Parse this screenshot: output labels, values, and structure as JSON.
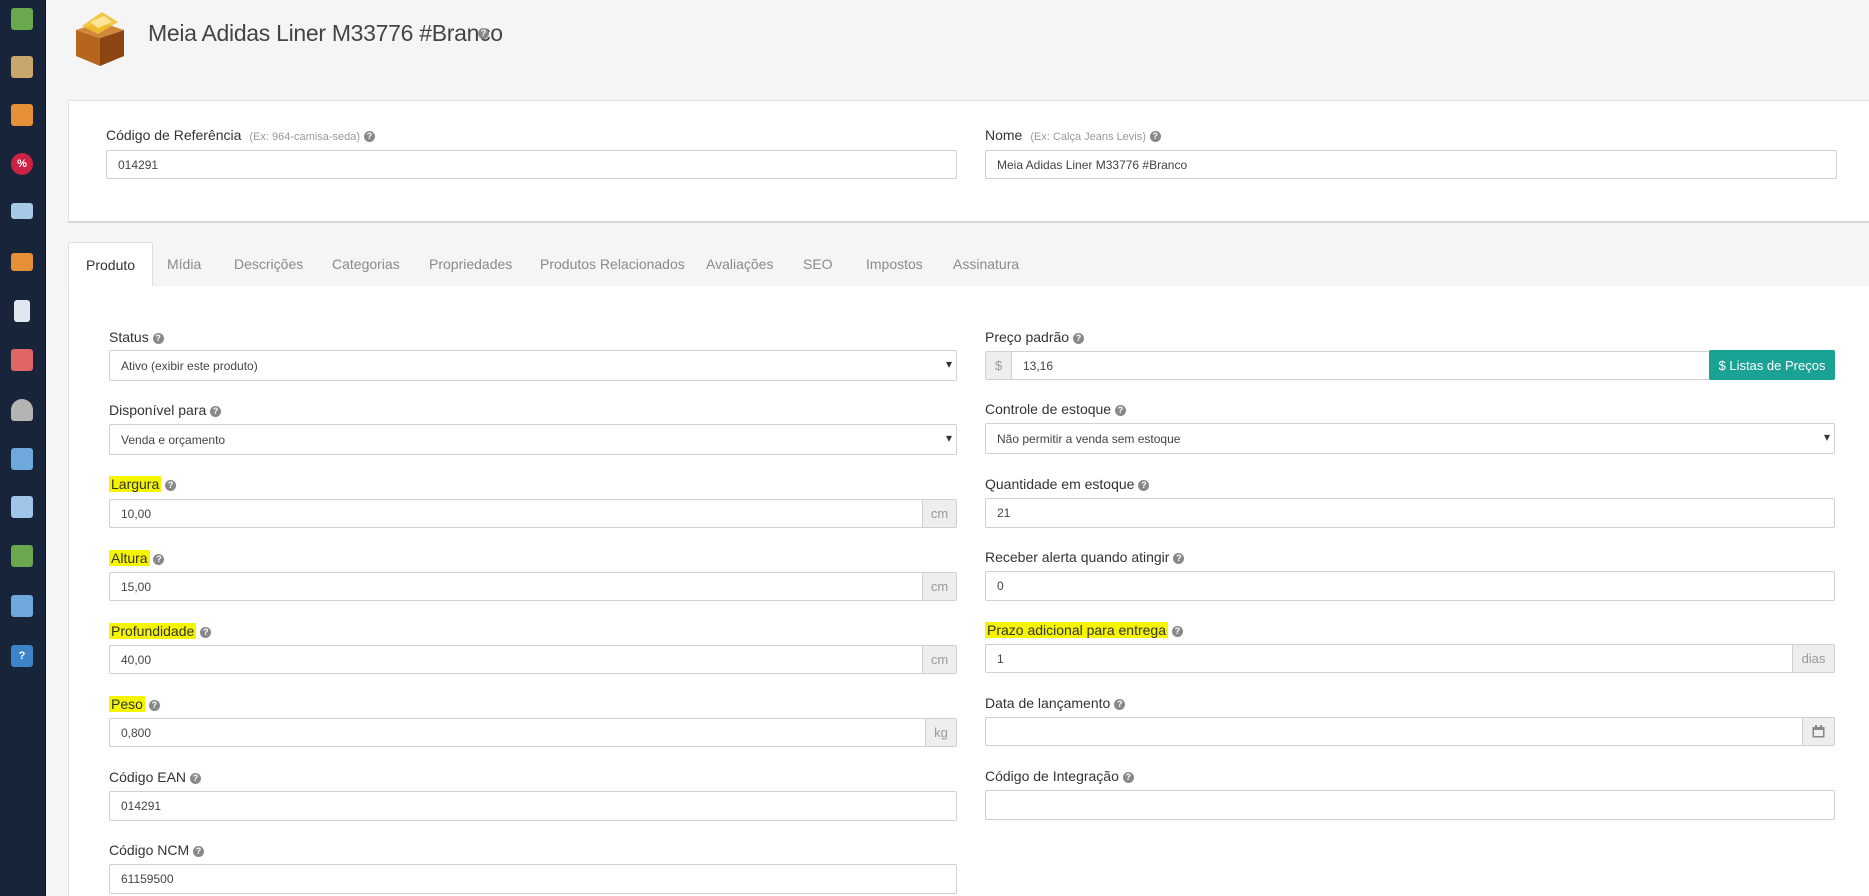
{
  "sidebar": {
    "items": [
      {
        "icon": "cube-icon",
        "color": "#6aa84f"
      },
      {
        "icon": "building-icon",
        "color": "#c9a66b"
      },
      {
        "icon": "box-icon",
        "color": "#e69138"
      },
      {
        "icon": "discount-icon",
        "color": "#cc2244"
      },
      {
        "icon": "card-icon",
        "color": "#a8c8e8"
      },
      {
        "icon": "truck-icon",
        "color": "#e69138"
      },
      {
        "icon": "document-icon",
        "color": "#dfe8f0"
      },
      {
        "icon": "users-icon",
        "color": "#e06666"
      },
      {
        "icon": "user-icon",
        "color": "#b4b4b4"
      },
      {
        "icon": "image-icon",
        "color": "#6fa8dc"
      },
      {
        "icon": "devices-icon",
        "color": "#9fc5e8"
      },
      {
        "icon": "chart-icon",
        "color": "#6aa84f"
      },
      {
        "icon": "settings-icon",
        "color": "#6fa8dc"
      },
      {
        "icon": "help-icon",
        "color": "#3d85c6"
      }
    ]
  },
  "header": {
    "title": "Meia Adidas Liner M33776 #Branco",
    "help": "?"
  },
  "top": {
    "ref_label": "Código de Referência",
    "ref_hint": "(Ex: 964-camisa-seda)",
    "ref_value": "014291",
    "name_label": "Nome",
    "name_hint": "(Ex: Calça Jeans Levis)",
    "name_value": "Meia Adidas Liner M33776 #Branco"
  },
  "tabs": [
    "Produto",
    "Mídia",
    "Descrições",
    "Categorias",
    "Propriedades",
    "Produtos Relacionados",
    "Avaliações",
    "SEO",
    "Impostos",
    "Assinatura"
  ],
  "form": {
    "status_label": "Status",
    "status_value": "Ativo (exibir este produto)",
    "disponivel_label": "Disponível para",
    "disponivel_value": "Venda e orçamento",
    "largura_label": "Largura",
    "largura_value": "10,00",
    "altura_label": "Altura",
    "altura_value": "15,00",
    "profundidade_label": "Profundidade",
    "profundidade_value": "40,00",
    "peso_label": "Peso",
    "peso_value": "0,800",
    "ean_label": "Código EAN",
    "ean_value": "014291",
    "ncm_label": "Código NCM",
    "ncm_value": "61159500",
    "unit_cm": "cm",
    "unit_kg": "kg",
    "preco_label": "Preço padrão",
    "preco_currency": "$",
    "preco_value": "13,16",
    "listas_button": "$ Listas de Preços",
    "controle_label": "Controle de estoque",
    "controle_value": "Não permitir a venda sem estoque",
    "quantidade_label": "Quantidade em estoque",
    "quantidade_value": "21",
    "alerta_label": "Receber alerta quando atingir",
    "alerta_value": "0",
    "prazo_label": "Prazo adicional para entrega",
    "prazo_value": "1",
    "prazo_unit": "dias",
    "data_label": "Data de lançamento",
    "data_value": "",
    "integracao_label": "Código de Integração",
    "integracao_value": ""
  },
  "colors": {
    "sidebar": "#17243a",
    "accent": "#1aa394",
    "highlight": "#f5f500"
  }
}
